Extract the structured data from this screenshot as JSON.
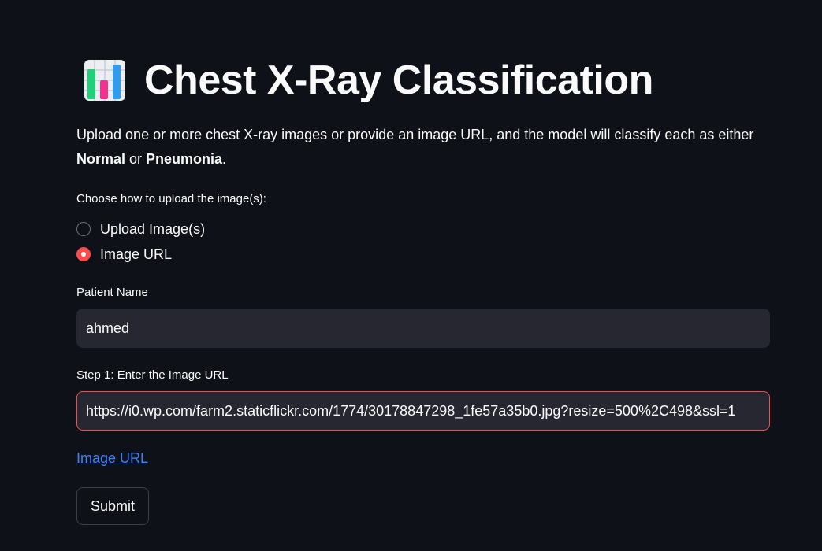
{
  "header": {
    "icon": "bar-chart-icon",
    "title": "Chest X-Ray Classification"
  },
  "description": {
    "part1": "Upload one or more chest X-ray images or provide an image URL, and the model will classify each as either ",
    "bold1": "Normal",
    "part2": " or ",
    "bold2": "Pneumonia",
    "part3": "."
  },
  "upload_method": {
    "label": "Choose how to upload the image(s):",
    "options": [
      {
        "label": "Upload Image(s)",
        "selected": false
      },
      {
        "label": "Image URL",
        "selected": true
      }
    ]
  },
  "patient": {
    "label": "Patient Name",
    "value": "ahmed"
  },
  "image_url": {
    "label": "Step 1: Enter the Image URL",
    "value": "https://i0.wp.com/farm2.staticflickr.com/1774/30178847298_1fe57a35b0.jpg?resize=500%2C498&ssl=1"
  },
  "link": {
    "label": "Image URL"
  },
  "submit": {
    "label": "Submit"
  },
  "colors": {
    "background": "#0e1117",
    "accent": "#ff4b4b",
    "input_bg": "#262730",
    "link": "#3b82f6"
  }
}
